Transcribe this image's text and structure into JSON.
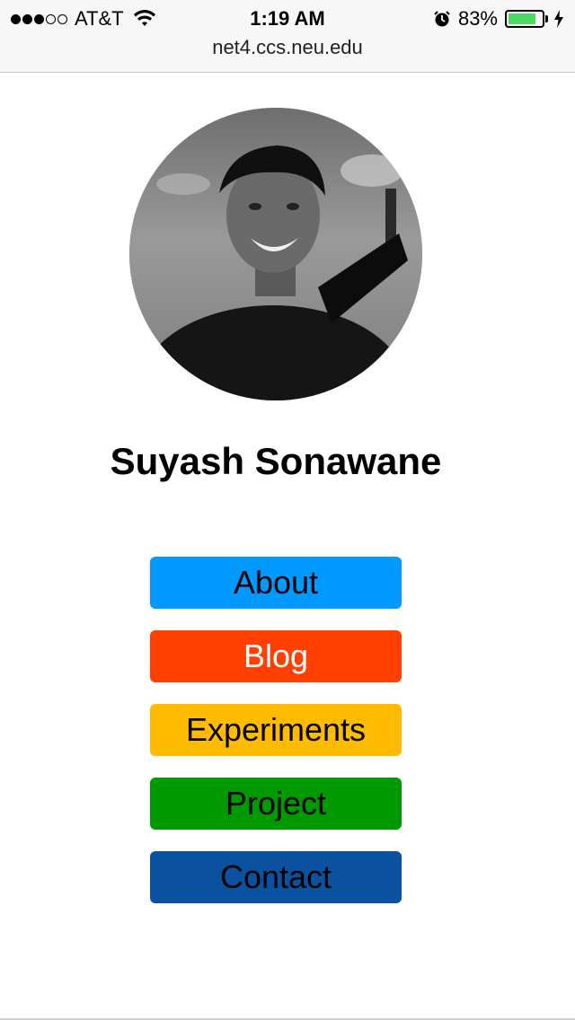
{
  "status_bar": {
    "carrier": "AT&T",
    "signal_bars_filled": 3,
    "signal_bars_total": 5,
    "time": "1:19 AM",
    "battery_percent_label": "83%",
    "battery_level": 0.83,
    "battery_color": "#4cd964"
  },
  "browser": {
    "url": "net4.ccs.neu.edu"
  },
  "profile": {
    "name": "Suyash Sonawane"
  },
  "nav": {
    "buttons": [
      {
        "label": "About",
        "bg": "#0099ff",
        "fg": "#000000"
      },
      {
        "label": "Blog",
        "bg": "#ff4000",
        "fg": "#ffffff"
      },
      {
        "label": "Experiments",
        "bg": "#ffbb00",
        "fg": "#000000"
      },
      {
        "label": "Project",
        "bg": "#009900",
        "fg": "#000000"
      },
      {
        "label": "Contact",
        "bg": "#0a52a0",
        "fg": "#000000"
      }
    ]
  }
}
